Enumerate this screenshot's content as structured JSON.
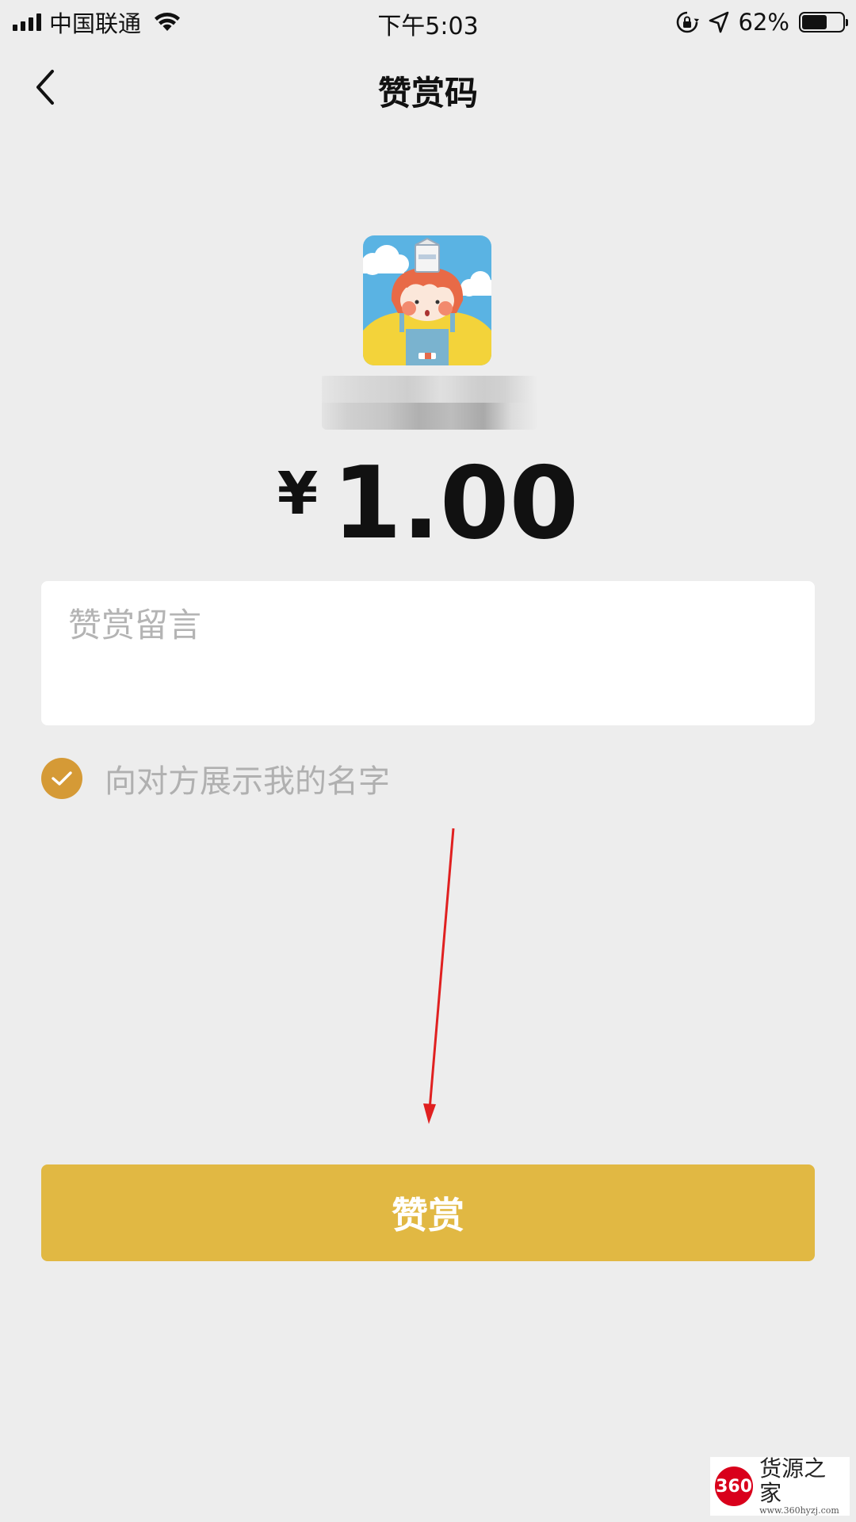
{
  "status_bar": {
    "carrier": "中国联通",
    "time": "下午5:03",
    "battery_percent": "62%",
    "battery_level": 0.62
  },
  "nav": {
    "title": "赞赏码",
    "back_icon": "chevron-left-icon"
  },
  "payee": {
    "avatar_icon": "cartoon-avatar"
  },
  "amount": {
    "currency": "¥",
    "value": "1.00"
  },
  "message": {
    "placeholder": "赞赏留言",
    "value": ""
  },
  "show_name": {
    "label": "向对方展示我的名字",
    "checked": true,
    "check_color": "#d59a36"
  },
  "submit": {
    "label": "赞赏",
    "color": "#e1b843"
  },
  "annotation": {
    "arrow_color": "#e02020"
  },
  "watermark": {
    "logo": "360",
    "text": "货源之家",
    "url": "www.360hyzj.com"
  }
}
